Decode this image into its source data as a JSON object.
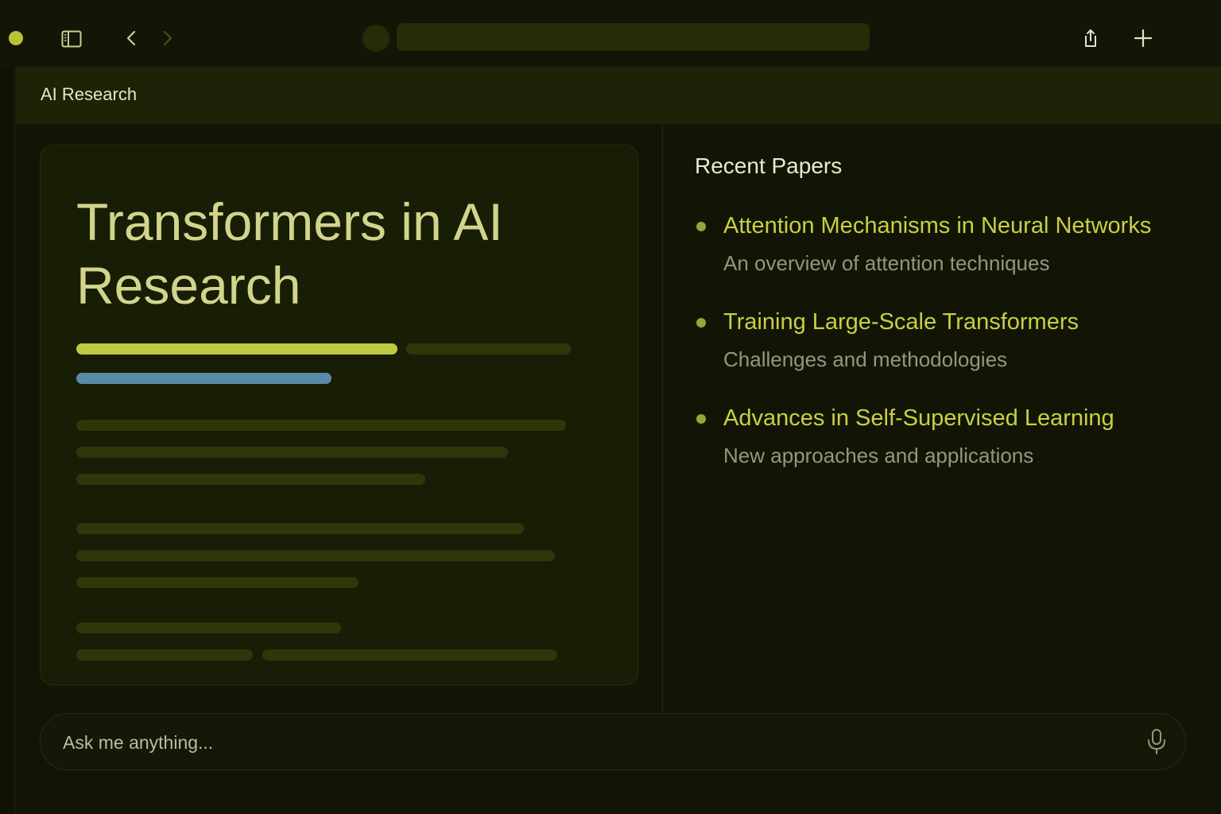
{
  "toolbar": {
    "icons": {
      "window": "window-dot",
      "sidebar": "sidebar-toggle-icon",
      "back": "chevron-left-icon",
      "forward": "chevron-right-icon",
      "share": "share-icon",
      "new_tab": "plus-icon"
    }
  },
  "tab": {
    "title": "AI Research"
  },
  "document": {
    "title": "Transformers in AI Research"
  },
  "recent": {
    "heading": "Recent Papers",
    "items": [
      {
        "title": "Attention Mechanisms in Neural Networks",
        "subtitle": "An overview of attention techniques"
      },
      {
        "title": "Training Large-Scale Transformers",
        "subtitle": "Challenges and methodologies"
      },
      {
        "title": "Advances in Self-Supervised Learning",
        "subtitle": "New approaches and applications"
      }
    ]
  },
  "ask": {
    "placeholder": "Ask me anything...",
    "mic_icon": "microphone-icon"
  },
  "colors": {
    "background": "#121506",
    "accent_yellow": "#c1c940",
    "accent_blue": "#5b8aa6",
    "title": "#d2d48c",
    "link": "#c9d041",
    "muted": "#949779"
  }
}
